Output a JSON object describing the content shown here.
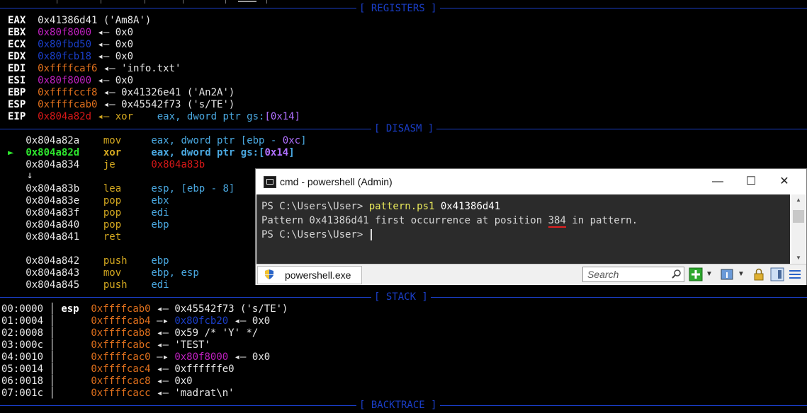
{
  "sections": {
    "registers": "[ REGISTERS ]",
    "disasm": "[ DISASM ]",
    "stack": "[ STACK ]",
    "backtrace": "[ BACKTRACE ]"
  },
  "registers": [
    {
      "name": "EAX",
      "value": "0x41386d41",
      "rest": " ('Am8A')"
    },
    {
      "name": "EBX",
      "value": "0x80f8000",
      "rest": " ◂— 0x0"
    },
    {
      "name": "ECX",
      "value": "0x80fbd50",
      "rest": " ◂— 0x0"
    },
    {
      "name": "EDX",
      "value": "0x80fcb18",
      "rest": " ◂— 0x0"
    },
    {
      "name": "EDI",
      "value": "0xffffcaf6",
      "rest": " ◂— 'info.txt'"
    },
    {
      "name": "ESI",
      "value": "0x80f8000",
      "rest": " ◂— 0x0"
    },
    {
      "name": "EBP",
      "value": "0xffffccf8",
      "rest": " ◂— 0x41326e41 ('An2A')"
    },
    {
      "name": "ESP",
      "value": "0xffffcab0",
      "rest": " ◂— 0x45542f73 ('s/TE')"
    },
    {
      "name": "EIP",
      "value": "0x804a82d",
      "rest_insn": " ◂— xor",
      "rest_ops": "    eax, dword ptr gs:",
      "rest_imm": "[0x14]"
    }
  ],
  "disasm": [
    {
      "addr": "0x804a82a",
      "mnem": "mov",
      "ops": "eax, dword ptr [ebp - ",
      "imm": "0xc",
      "tail": "]",
      "current": false
    },
    {
      "addr": "0x804a82d",
      "mnem": "xor",
      "ops": "eax, dword ptr gs:[",
      "imm": "0x14",
      "tail": "]",
      "current": true
    },
    {
      "addr": "0x804a834",
      "mnem": "je",
      "ops": "",
      "target": "0x804a83b",
      "current": false
    },
    {
      "addr": "0x804a83b",
      "mnem": "lea",
      "ops": "esp, [ebp - 8]",
      "current": false
    },
    {
      "addr": "0x804a83e",
      "mnem": "pop",
      "ops": "ebx",
      "current": false
    },
    {
      "addr": "0x804a83f",
      "mnem": "pop",
      "ops": "edi",
      "current": false
    },
    {
      "addr": "0x804a840",
      "mnem": "pop",
      "ops": "ebp",
      "current": false
    },
    {
      "addr": "0x804a841",
      "mnem": "ret",
      "ops": "",
      "current": false
    },
    {
      "addr": "0x804a842",
      "mnem": "push",
      "ops": "ebp",
      "current": false
    },
    {
      "addr": "0x804a843",
      "mnem": "mov",
      "ops": "ebp, esp",
      "current": false
    },
    {
      "addr": "0x804a845",
      "mnem": "push",
      "ops": "edi",
      "current": false
    }
  ],
  "current_marker": "►",
  "jump_arrow": "↓",
  "stack": [
    {
      "off": "00:0000",
      "reg": "esp",
      "addr": "0xffffcab0",
      "mid_arrow": " ◂— ",
      "rest": "0x45542f73 ('s/TE')"
    },
    {
      "off": "01:0004",
      "reg": "",
      "addr": "0xffffcab4",
      "mid_arrow": " —▸ ",
      "ptr": "0x80fcb20",
      "rest": " ◂— 0x0"
    },
    {
      "off": "02:0008",
      "reg": "",
      "addr": "0xffffcab8",
      "mid_arrow": " ◂— ",
      "rest": "0x59 /* 'Y' */"
    },
    {
      "off": "03:000c",
      "reg": "",
      "addr": "0xffffcabc",
      "mid_arrow": " ◂— ",
      "rest": "'TEST'"
    },
    {
      "off": "04:0010",
      "reg": "",
      "addr": "0xffffcac0",
      "mid_arrow": " —▸ ",
      "ptr": "0x80f8000",
      "rest": " ◂— 0x0"
    },
    {
      "off": "05:0014",
      "reg": "",
      "addr": "0xffffcac4",
      "mid_arrow": " ◂— ",
      "rest": "0xffffffe0"
    },
    {
      "off": "06:0018",
      "reg": "",
      "addr": "0xffffcac8",
      "mid_arrow": " ◂— ",
      "rest": "0x0"
    },
    {
      "off": "07:001c",
      "reg": "",
      "addr": "0xffffcacc",
      "mid_arrow": " ◂— ",
      "rest": "'madrat\\n'"
    }
  ],
  "window": {
    "title": "cmd - powershell (Admin)",
    "minimize": "—",
    "maximize": "☐",
    "close": "✕",
    "console": {
      "line1_prompt": "PS C:\\Users\\User> ",
      "line1_cmd": "pattern.ps1",
      "line1_arg": " 0x41386d41",
      "line2_pre": "Pattern 0x41386d41 first occurrence at position ",
      "line2_num": "384",
      "line2_post": " in pattern.",
      "line3_prompt": "PS C:\\Users\\User> "
    },
    "tab_label": "powershell.exe",
    "search_placeholder": "Search"
  },
  "colors": {
    "background": "#000000",
    "separator": "#1a3ec8",
    "console_bg": "#2b2b2b"
  }
}
